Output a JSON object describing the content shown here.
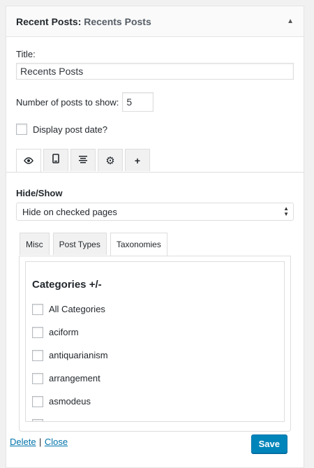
{
  "widget": {
    "title": "Recent Posts:",
    "subtitle": "Recents Posts"
  },
  "form": {
    "title_label": "Title:",
    "title_value": "Recents Posts",
    "number_label": "Number of posts to show:",
    "number_value": "5",
    "display_date_label": "Display post date?"
  },
  "tabs": [
    {
      "icon": "eye-icon",
      "glyph": "👁"
    },
    {
      "icon": "mobile-icon",
      "glyph": "▯"
    },
    {
      "icon": "align-center-icon",
      "glyph": "≡"
    },
    {
      "icon": "gear-icon",
      "glyph": "⚙"
    },
    {
      "icon": "plus-icon",
      "glyph": "+"
    }
  ],
  "hide_show": {
    "label": "Hide/Show",
    "selected": "Hide on checked pages"
  },
  "subtabs": {
    "misc": "Misc",
    "post_types": "Post Types",
    "taxonomies": "Taxonomies"
  },
  "categories": {
    "title": "Categories +/-",
    "items": [
      "All Categories",
      "aciform",
      "antiquarianism",
      "arrangement",
      "asmodeus"
    ]
  },
  "footer": {
    "delete": "Delete",
    "separator": "|",
    "close": "Close",
    "save": "Save"
  },
  "colors": {
    "link": "#0073aa",
    "primary_button": "#0085ba"
  }
}
